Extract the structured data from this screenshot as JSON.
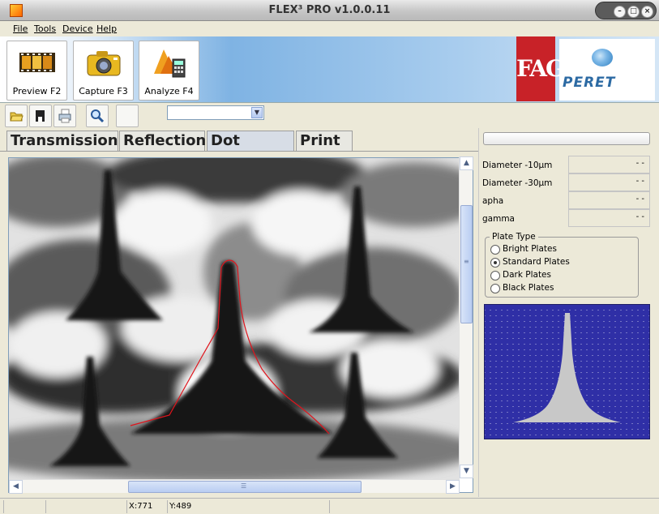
{
  "window": {
    "title": "FLEX³ PRO v1.0.0.11",
    "controls": [
      "minimize",
      "maximize",
      "close"
    ]
  },
  "menu": {
    "items": [
      "File",
      "Tools",
      "Device",
      "Help"
    ]
  },
  "toolbar": {
    "buttons": [
      {
        "label": "Preview F2",
        "icon": "film-strip-icon"
      },
      {
        "label": "Capture F3",
        "icon": "camera-icon"
      },
      {
        "label": "Analyze F4",
        "icon": "calculator-icon"
      }
    ],
    "logos": {
      "left": "FAG",
      "right": "PERET"
    }
  },
  "small_toolbar": {
    "icons": [
      "open-folder-icon",
      "save-icon",
      "print-icon",
      "zoom-icon",
      "blank-icon"
    ],
    "combo_value": ""
  },
  "tabs": [
    "Transmission",
    "Reflection",
    "Dot Shape",
    "Print"
  ],
  "active_tab": "Dot Shape",
  "measurements": [
    {
      "label": "Diameter  -10µm",
      "value": "- -"
    },
    {
      "label": "Diameter  -30µm",
      "value": "- -"
    },
    {
      "label": "apha",
      "value": "- -"
    },
    {
      "label": "gamma",
      "value": "- -"
    }
  ],
  "plate_type": {
    "title": "Plate Type",
    "options": [
      "Bright Plates",
      "Standard Plates",
      "Dark Plates",
      "Black Plates"
    ],
    "selected": "Standard Plates"
  },
  "colors": {
    "profile_line": "#e0141c",
    "preview_background": "#2f2fa6",
    "preview_shape": "#c8c8c8",
    "fag_red": "#c82228",
    "peret_blue": "#2c6aa3"
  },
  "status": {
    "x": "X:771",
    "y": "Y:489"
  }
}
